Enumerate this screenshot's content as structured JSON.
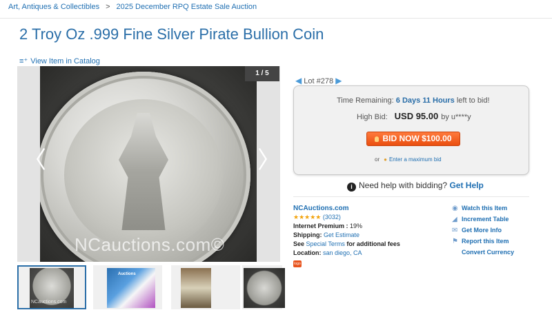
{
  "breadcrumb": {
    "items": [
      "Art, Antiques & Collectibles",
      "2025 December RPQ Estate Sale Auction"
    ],
    "separator": ">"
  },
  "title": "2 Troy Oz .999 Fine Silver Pirate Bullion Coin",
  "catalog_link": "View Item in Catalog",
  "gallery": {
    "counter": "1 / 5",
    "watermark": "NCauctions.com©",
    "thumb_watermark": "NCauctions.com",
    "thumb2_text": "Auctions"
  },
  "lot": {
    "label": "Lot #278"
  },
  "bidding": {
    "time_label": "Time Remaining:",
    "time_value": "6 Days 11 Hours",
    "time_suffix": "left to bid!",
    "high_bid_label": "High Bid:",
    "high_bid_amount": "USD 95.00",
    "high_bid_by": "by u****y",
    "bid_button": "BID NOW $100.00",
    "or_text": "or",
    "max_bid_link": "Enter a maximum bid"
  },
  "help": {
    "text": "Need help with bidding?",
    "link": "Get Help"
  },
  "seller": {
    "name": "NCAuctions.com",
    "stars": "★★★★★",
    "rating_count": "(3032)",
    "premium_label": "Internet Premium :",
    "premium_value": "19%",
    "shipping_label": "Shipping:",
    "shipping_link": "Get Estimate",
    "terms_prefix": "See",
    "terms_link": "Special Terms",
    "terms_suffix": "for additional fees",
    "location_label": "Location:",
    "location_value": "san diego, CA",
    "badge": "logo"
  },
  "actions": {
    "watch": "Watch this Item",
    "increment": "Increment Table",
    "info": "Get More Info",
    "report": "Report this Item",
    "currency": "Convert Currency"
  },
  "colors": {
    "link": "#1f6fb2",
    "title": "#2a6ea8",
    "bid_button": "#ea4f10",
    "stars": "#f2a20a"
  }
}
